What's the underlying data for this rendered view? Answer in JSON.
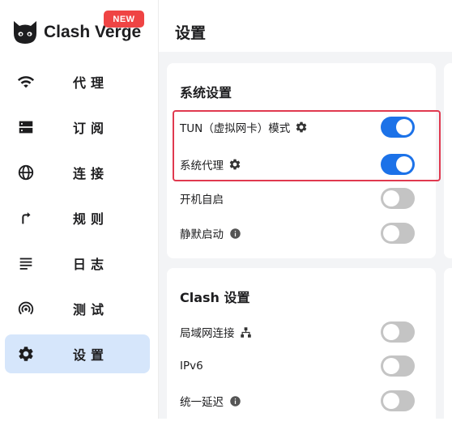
{
  "app": {
    "name": "Clash Verge",
    "badge": "NEW"
  },
  "sidebar": {
    "items": [
      {
        "label": "代理",
        "icon": "wifi-icon"
      },
      {
        "label": "订阅",
        "icon": "storage-icon"
      },
      {
        "label": "连接",
        "icon": "globe-icon"
      },
      {
        "label": "规则",
        "icon": "fork-arrow-icon"
      },
      {
        "label": "日志",
        "icon": "list-lines-icon"
      },
      {
        "label": "测试",
        "icon": "broadcast-icon"
      },
      {
        "label": "设置",
        "icon": "gear-icon",
        "active": true
      }
    ]
  },
  "page": {
    "title": "设置"
  },
  "system_settings": {
    "title": "系统设置",
    "rows": [
      {
        "label": "TUN（虚拟网卡）模式",
        "icon": "gear-icon",
        "enabled": true
      },
      {
        "label": "系统代理",
        "icon": "gear-icon",
        "enabled": true
      },
      {
        "label": "开机自启",
        "enabled": false
      },
      {
        "label": "静默启动",
        "icon": "info-icon",
        "enabled": false
      }
    ]
  },
  "clash_settings": {
    "title": "Clash 设置",
    "rows": [
      {
        "label": "局域网连接",
        "icon": "network-icon",
        "enabled": false
      },
      {
        "label": "IPv6",
        "enabled": false
      },
      {
        "label": "统一延迟",
        "icon": "info-icon",
        "enabled": false
      }
    ]
  },
  "colors": {
    "accent": "#1c72e8",
    "active_nav": "#d6e6fb",
    "highlight_border": "#e0394f",
    "badge": "#ef4444"
  }
}
